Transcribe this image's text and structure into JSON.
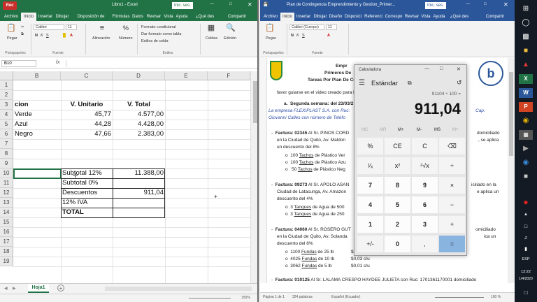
{
  "excel": {
    "app_badge": "Rec",
    "title": "Libro1 - Excel",
    "signin": "Inic. ses.",
    "share": "Compartir",
    "search": "¿Qué des",
    "tabs": [
      "Archivo",
      "Inicio",
      "Insertar",
      "Dibujar",
      "Disposición de página",
      "Fórmulas",
      "Datos",
      "Revisar",
      "Vista",
      "Ayuda"
    ],
    "ribbon": {
      "paste": "Pegar",
      "clipboard": "Portapapeles",
      "font_name": "Calibri",
      "font_size": "11",
      "font_group": "Fuente",
      "align": "Alineación",
      "number": "Número",
      "cond_format": "Formato condicional",
      "table_format": "Dar formato como tabla",
      "cell_styles": "Estilos de celda",
      "styles_group": "Estilos",
      "cells": "Celdas",
      "editing": "Edición"
    },
    "name_box": "B10",
    "fx": "fx",
    "columns": [
      "B",
      "C",
      "D",
      "E",
      "F"
    ],
    "rows": [
      "1",
      "2",
      "3",
      "4",
      "5",
      "6",
      "7",
      "8",
      "9",
      "10",
      "11",
      "12",
      "13",
      "14",
      "15",
      "16",
      "17",
      "18",
      "19"
    ],
    "cells": {
      "b3": "cion",
      "c3": "V. Unitario",
      "d3": "V. Total",
      "b4": "Verde",
      "c4": "45,77",
      "d4": "4.577,00",
      "b5": "Azul",
      "c5": "44,28",
      "d5": "4.428,00",
      "b6": "Negro",
      "c6": "47,66",
      "d6": "2.383,00",
      "c10": "Subtotal 12%",
      "d10": "11.388,00",
      "c11": "Subtotal 0%",
      "c12": "Descuentos",
      "d12": "911,04",
      "c13": "12% IVA",
      "c14": "TOTAL"
    },
    "sheet_tab": "Hoja1",
    "zoom": "150%"
  },
  "word": {
    "title": "Plan de Contingencia Emprendimiento y Gestion_Primer...",
    "signin": "Inic. ses.",
    "share": "Compartir",
    "search": "¿Qué des",
    "tabs": [
      "Archivo",
      "Inicio",
      "Insertar",
      "Dibujar",
      "Diseño",
      "Disposici",
      "Referenci",
      "Correspo",
      "Revisar",
      "Vista",
      "Ayuda"
    ],
    "ribbon": {
      "paste": "Pegar",
      "clipboard": "Portapapeles",
      "font_name": "Calibri (Cuerpo)",
      "font_size": "11",
      "font_group": "Fuente",
      "paragraph": "Párrafo",
      "styles": "Estilos",
      "editing": "Edición"
    },
    "doc": {
      "h1": "Empr",
      "h2": "Primeros De",
      "h3": "Tareas Por Plan De Con",
      "intro": "favor guiarse en el video creado para la n",
      "week": "Segunda semana: del 23/03/2",
      "p1": "La empresa FLEXIPLAST S.A. con Ruc: ",
      "p1_end": "Cap.",
      "p2": "Giovanni Calles con número de Teléfo",
      "f1_label": "Factura: 02345",
      "f1_text": " Al Sr. PINOS CORD",
      "f1_end": "domiciliado",
      "f1_l2": "en la Ciudad de Quito, Av. Maldon",
      "f1_l2_end": ", se aplica",
      "f1_l3": "un descuento del 8%",
      "i1": "100 ",
      "i1_u": "Tachos",
      "i1_t": " de Plástico Ver",
      "i2": "100 ",
      "i2_u": "Tachos",
      "i2_t": " de Plástico Azu",
      "i3": "50 ",
      "i3_u": "Tachos",
      "i3_t": " de Plástico Neg",
      "f2_label": "Factura: 09273",
      "f2_text": " Al Sr. APOLO ASAN",
      "f2_end": "iciliado en la",
      "f2_l2": "Ciudad de Latacunga, Av. Amazon",
      "f2_l2_end": "e aplica un",
      "f2_l3": "descuento del 4%",
      "j1": "3 ",
      "j1_u": "Tanques",
      "j1_t": " de Agua de 500",
      "j2": "3 ",
      "j2_u": "Tanques",
      "j2_t": " de Agua de 250",
      "f3_label": "Factura: 04060",
      "f3_text": " Al Sr. ROSERO GUT",
      "f3_end": "omiciliado",
      "f3_l2": "en la Ciudad de Quito, Av. Solanda",
      "f3_l2_end": "ica un",
      "f3_l3": "descuento del 6%",
      "k1": "1100 ",
      "k1_u": "Fundas",
      "k1_t": " de 25 lb",
      "k1_p": "$",
      "k2": "4025 ",
      "k2_u": "Fundas",
      "k2_t": " de 10 lb",
      "k2_p": "$0,03 c/u",
      "k3": "3062 ",
      "k3_u": "Fundas",
      "k3_t": " de  5 lb",
      "k3_p": "$0,01 c/u",
      "f4_label": "Factura: 010125",
      "f4_text": " Al Sr. LALAMA CRESPO HAYDEE JULIETA con Ruc: 1701361170001 domiciliado"
    },
    "status_page": "Página 1 de 1",
    "status_words": "324 palabras",
    "status_lang": "Español (Ecuador)",
    "zoom": "100 %"
  },
  "calculator": {
    "title": "Calculadora",
    "mode": "Estándar",
    "expression": "91104 ÷ 100 =",
    "display": "911,04",
    "memory": [
      "MC",
      "MR",
      "M+",
      "M-",
      "MS",
      "M˅"
    ],
    "keys": [
      [
        "%",
        "CE",
        "C",
        "⌫"
      ],
      [
        "¹⁄ₓ",
        "x²",
        "²√x",
        "÷"
      ],
      [
        "7",
        "8",
        "9",
        "×"
      ],
      [
        "4",
        "5",
        "6",
        "−"
      ],
      [
        "1",
        "2",
        "3",
        "+"
      ],
      [
        "+/-",
        "0",
        ",",
        "="
      ]
    ]
  },
  "taskbar": {
    "lang": "ESP",
    "time": "12:22",
    "date": "1/4/2020"
  }
}
